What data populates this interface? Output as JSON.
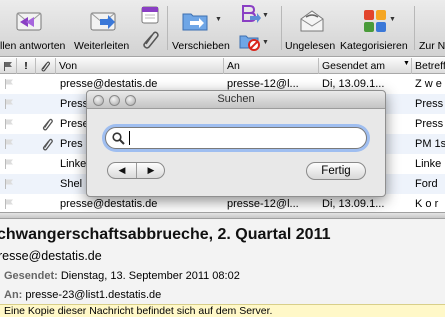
{
  "toolbar": {
    "reply_all_label": "llen antworten",
    "forward_label": "Weiterleiten",
    "move_label": "Verschieben",
    "unread_label": "Ungelesen",
    "categorize_label": "Kategorisieren",
    "extra_label": "Zur N"
  },
  "list": {
    "columns": [
      "Von",
      "An",
      "Gesendet am",
      "Betreff"
    ],
    "rows": [
      {
        "from": "presse@destatis.de",
        "to": "presse-12@l...",
        "sent": "Di, 13.09.1...",
        "subject": "Z w e",
        "attachment": false
      },
      {
        "from": "Presse",
        "to": "",
        "sent": "",
        "subject": "Press",
        "attachment": false
      },
      {
        "from": "Prese",
        "to": "",
        "sent": "",
        "subject": "Press",
        "attachment": true
      },
      {
        "from": "Pres",
        "to": "",
        "sent": "",
        "subject": "PM 1s",
        "attachment": true
      },
      {
        "from": "Linke",
        "to": "",
        "sent": "",
        "subject": "Linke",
        "attachment": false
      },
      {
        "from": "Shel",
        "to": "",
        "sent": "",
        "subject": "Ford",
        "attachment": false
      },
      {
        "from": "presse@destatis.de",
        "to": "presse-12@l...",
        "sent": "Di, 13.09.1...",
        "subject": "K o r",
        "attachment": false
      }
    ]
  },
  "search_dialog": {
    "title": "Suchen",
    "query": "",
    "prev_glyph": "◀",
    "next_glyph": "▶",
    "done_label": "Fertig"
  },
  "preview": {
    "subject": "chwangerschaftsabbrueche, 2. Quartal 2011",
    "from": "resse@destatis.de",
    "sent_key": "Gesendet:",
    "sent_value": "Dienstag, 13. September 2011 08:02",
    "to_key": "An:",
    "to_value": "presse-23@list1.destatis.de",
    "notice": "Eine Kopie dieser Nachricht befindet sich auf dem Server."
  },
  "colors": {
    "accent_focus": "#9fbef0",
    "notice_bg": "#fff8c8",
    "alt_row": "#eef3fb"
  },
  "icons": [
    "reply-all-icon",
    "forward-icon",
    "calendar-icon",
    "attach-icon",
    "move-folder-icon",
    "rules-icon",
    "folder-block-icon",
    "unread-envelope-icon",
    "categorize-icon",
    "search-icon",
    "flag-icon",
    "paperclip-icon"
  ]
}
